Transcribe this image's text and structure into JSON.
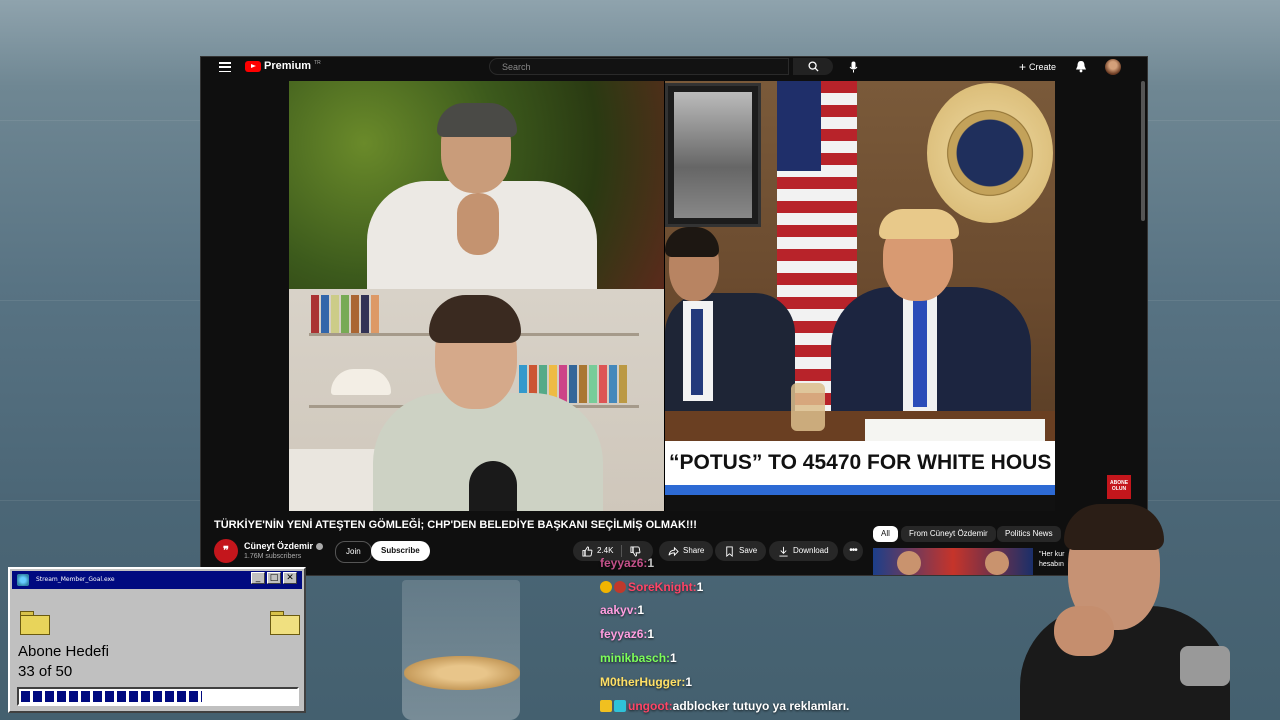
{
  "youtube": {
    "brand": "Premium",
    "region": "TR",
    "search_placeholder": "Search",
    "create_label": "Create"
  },
  "video": {
    "caption": "“POTUS” TO 45470 FOR WHITE HOUS",
    "seal_text": "SEAL OF THE PRESIDENT OF THE UNITED STATES",
    "badge": "ABONE OLUN",
    "title": "TÜRKİYE'NİN YENİ ATEŞTEN GÖMLEĞİ; CHP'DEN BELEDİYE BAŞKANI SEÇİLMİŞ OLMAK!!!"
  },
  "channel": {
    "name": "Cüneyt Özdemir",
    "subscribers": "1.76M subscribers",
    "join_label": "Join",
    "subscribe_label": "Subscribe"
  },
  "actions": {
    "likes": "2.4K",
    "share": "Share",
    "save": "Save",
    "download": "Download"
  },
  "chips": [
    "All",
    "From Cüneyt Özdemir",
    "Politics News"
  ],
  "recommended": {
    "text1": "\"Her kur",
    "text2": "hesabın"
  },
  "goal_widget": {
    "window_title": "Stream_Member_Goal.exe",
    "title": "Abone Hedefi",
    "count": "33 of 50",
    "current": 33,
    "target": 50
  },
  "chat": [
    {
      "user": "feyyaz6:",
      "text": " 1 ",
      "color": "#ff66b2"
    },
    {
      "user": "SoreKnight:",
      "text": " 1",
      "color": "#ff4466"
    },
    {
      "user": "aakyv:",
      "text": " 1",
      "color": "#ff9ee0"
    },
    {
      "user": "feyyaz6:",
      "text": " 1",
      "color": "#ff9ee0"
    },
    {
      "user": "minikbasch:",
      "text": " 1",
      "color": "#7dff5a"
    },
    {
      "user": "M0therHugger:",
      "text": " 1",
      "color": "#ffe066"
    },
    {
      "user": "ungoot:",
      "text": " adblocker tutuyo ya reklamları.",
      "color": "#ff4466"
    }
  ],
  "colors": {
    "youtube_red": "#ff0000",
    "win_titlebar": "#000a80",
    "caption_blue": "#2d6ad4"
  }
}
